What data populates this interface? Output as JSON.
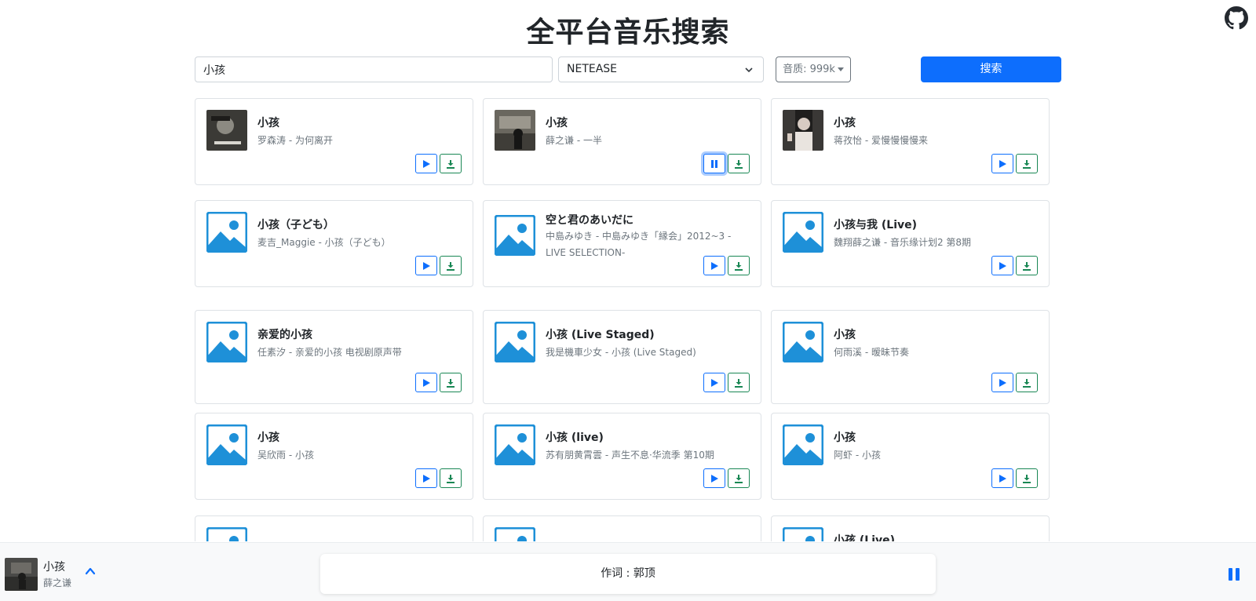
{
  "header": {
    "title": "全平台音乐搜索",
    "github_icon": "github-icon"
  },
  "search": {
    "query": "小孩",
    "source": "NETEASE",
    "quality_label": "音质: 999k",
    "button_label": "搜索"
  },
  "results": [
    {
      "title": "小孩",
      "subtitle": "罗森涛 - 为何离开",
      "cover": "photo",
      "playing": false
    },
    {
      "title": "小孩",
      "subtitle": "薛之谦 - 一半",
      "cover": "photo",
      "playing": true
    },
    {
      "title": "小孩",
      "subtitle": "蒋孜怡 - 爱慢慢慢慢来",
      "cover": "photo",
      "playing": false
    },
    {
      "title": "小孩（子ども）",
      "subtitle": "麦吉_Maggie - 小孩（子ども）",
      "cover": "placeholder",
      "playing": false
    },
    {
      "title": "空と君のあいだに",
      "subtitle": "中島みゆき - 中島みゆき「縁会」2012~3 -LIVE SELECTION-",
      "cover": "placeholder",
      "playing": false
    },
    {
      "title": "小孩与我 (Live)",
      "subtitle": "魏翔薛之谦 - 音乐缘计划2 第8期",
      "cover": "placeholder",
      "playing": false
    },
    {
      "title": "亲爱的小孩",
      "subtitle": "任素汐 - 亲爱的小孩 电视剧原声带",
      "cover": "placeholder",
      "playing": false
    },
    {
      "title": "小孩 (Live Staged)",
      "subtitle": "我是機車少女 - 小孩 (Live Staged)",
      "cover": "placeholder",
      "playing": false
    },
    {
      "title": "小孩",
      "subtitle": "何雨溪 - 暧昧节奏",
      "cover": "placeholder",
      "playing": false
    },
    {
      "title": "小孩",
      "subtitle": "吴欣雨 - 小孩",
      "cover": "placeholder",
      "playing": false
    },
    {
      "title": "小孩 (live)",
      "subtitle": "苏有朋黄霄雲 - 声生不息·华流季 第10期",
      "cover": "placeholder",
      "playing": false
    },
    {
      "title": "小孩",
      "subtitle": "阿虾 - 小孩",
      "cover": "placeholder",
      "playing": false
    },
    {
      "title": "",
      "subtitle": "",
      "cover": "placeholder",
      "playing": false
    },
    {
      "title": "",
      "subtitle": "",
      "cover": "placeholder",
      "playing": false
    },
    {
      "title": "小孩 (Live)",
      "subtitle": "",
      "cover": "placeholder",
      "playing": false
    }
  ],
  "player": {
    "title": "小孩",
    "artist": "薛之谦",
    "lyric": "作词 : 郭顶"
  },
  "colors": {
    "primary": "#0d6efd",
    "success": "#198754",
    "placeholder_blue": "#1e90d8"
  }
}
